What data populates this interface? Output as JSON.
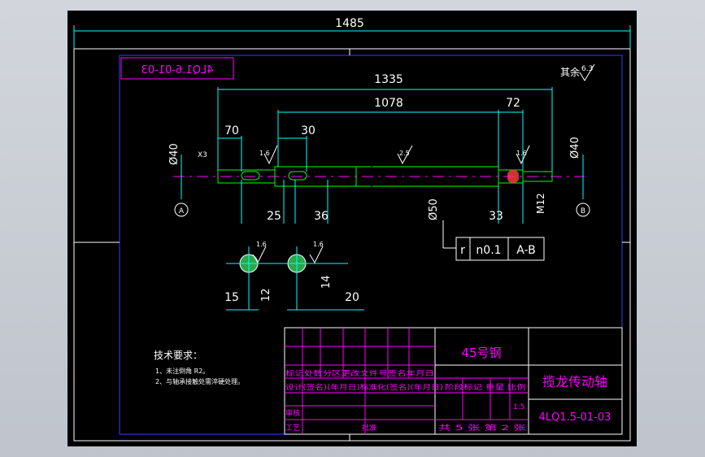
{
  "drawing": {
    "overall_length": "1485",
    "mirrored_code": "4LQ1.6-01-03",
    "surface_note": "其余",
    "surface_default": "6.3",
    "dims": {
      "d1335": "1335",
      "d1078": "1078",
      "d72": "72",
      "d70": "70",
      "d30": "30",
      "d25": "25",
      "d36": "36",
      "d33": "33",
      "d15": "15",
      "d12": "12",
      "d14": "14",
      "d20": "20",
      "phi40_left": "Ø40",
      "phi40_right": "Ø40",
      "phi50": "Ø50",
      "m12": "M12",
      "chamfer": "X3"
    },
    "roughness": {
      "r1": "1.6",
      "r2": "1.6",
      "r3": "2.5",
      "r4": "1.6",
      "r5": "1.6",
      "r6": "1.6"
    },
    "datums": {
      "a": "A",
      "b": "B"
    },
    "tolerance_frame": {
      "symbol": "r",
      "value": "n0.1",
      "datum": "A-B"
    },
    "tech_requirements": {
      "title": "技术要求：",
      "item1": "1、未注倒角 R2。",
      "item2": "2、与轴承接触处需淬硬处理。"
    },
    "title_block": {
      "material": "45号钢",
      "part_name": "揽龙传动轴",
      "drawing_no": "4LQ1.5-01-03",
      "row_mark": "标记处数分区更改文件号签名年月日",
      "row_design": "设计(签名)(年月日)标准化(签名)(年月日)",
      "stage_label": "阶段标记 重量 比例",
      "scale": "1:5",
      "review": "审核",
      "process": "工艺",
      "approve": "批准",
      "sheets": "共 5 张 第 2 张"
    }
  }
}
